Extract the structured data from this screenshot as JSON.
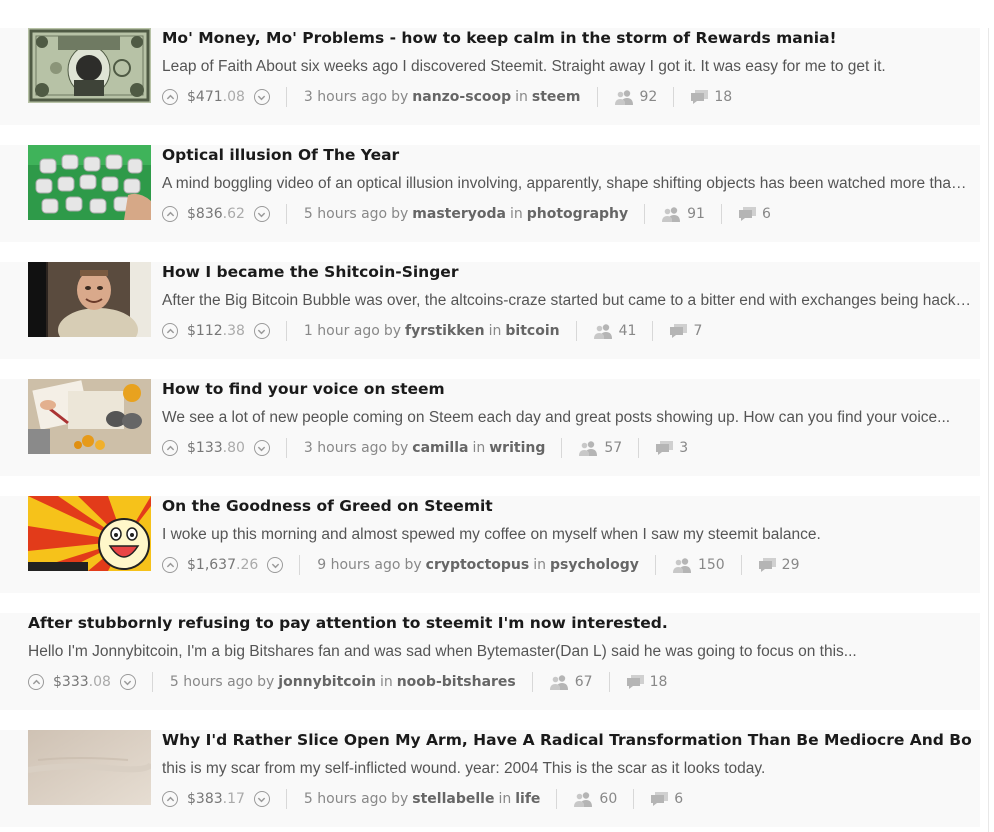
{
  "posts": [
    {
      "title": "Mo' Money, Mo' Problems - how to keep calm in the storm of Rewards mania!",
      "summary": "Leap of Faith About six weeks ago I discovered Steemit. Straight away I got it. It was easy for me to get it.",
      "payout_main": "$471",
      "payout_cents": ".08",
      "time": "3 hours ago",
      "author": "nanzo-scoop",
      "category": "steem",
      "voters": "92",
      "comments": "18",
      "thumbnail": "money-bill-image",
      "has_thumb": true
    },
    {
      "title": "Optical illusion Of The Year",
      "summary": "A mind boggling video of an optical illusion involving, apparently, shape shifting objects has been watched more than...",
      "payout_main": "$836",
      "payout_cents": ".62",
      "time": "5 hours ago",
      "author": "masteryoda",
      "category": "photography",
      "voters": "91",
      "comments": "6",
      "thumbnail": "optical-illusion-image",
      "has_thumb": true
    },
    {
      "title": "How I became the Shitcoin-Singer",
      "summary": "After the Big Bitcoin Bubble was over, the altcoins-craze started but came to a bitter end with exchanges being hacked...",
      "payout_main": "$112",
      "payout_cents": ".38",
      "time": "1 hour ago",
      "author": "fyrstikken",
      "category": "bitcoin",
      "voters": "41",
      "comments": "7",
      "thumbnail": "singer-photo",
      "has_thumb": true
    },
    {
      "title": "How to find your voice on steem",
      "summary": "We see a lot of new people coming on Steem each day and great posts showing up. How can you find your voice...",
      "payout_main": "$133",
      "payout_cents": ".80",
      "time": "3 hours ago",
      "author": "camilla",
      "category": "writing",
      "voters": "57",
      "comments": "3",
      "thumbnail": "desk-writing-image",
      "has_thumb": true
    },
    {
      "title": "On the Goodness of Greed on Steemit",
      "summary": "I woke up this morning and almost spewed my coffee on myself when I saw my steemit balance.",
      "payout_main": "$1,637",
      "payout_cents": ".26",
      "time": "9 hours ago",
      "author": "cryptoctopus",
      "category": "psychology",
      "voters": "150",
      "comments": "29",
      "thumbnail": "rage-face-image",
      "has_thumb": true
    },
    {
      "title": "After stubbornly refusing to pay attention to steemit I'm now interested.",
      "summary": "Hello I'm Jonnybitcoin, I'm a big Bitshares fan and was sad when Bytemaster(Dan L) said he was going to focus on this...",
      "payout_main": "$333",
      "payout_cents": ".08",
      "time": "5 hours ago",
      "author": "jonnybitcoin",
      "category": "noob-bitshares",
      "voters": "67",
      "comments": "18",
      "thumbnail": "",
      "has_thumb": false
    },
    {
      "title": "Why I'd Rather Slice Open My Arm, Have A Radical Transformation Than Be Mediocre And Boring",
      "summary": "this is my scar from my self-inflicted wound. year: 2004 This is the scar as it looks today.",
      "payout_main": "$383",
      "payout_cents": ".17",
      "time": "5 hours ago",
      "author": "stellabelle",
      "category": "life",
      "voters": "60",
      "comments": "6",
      "thumbnail": "scar-photo",
      "has_thumb": true
    }
  ],
  "labels": {
    "by": "by",
    "in": "in"
  }
}
